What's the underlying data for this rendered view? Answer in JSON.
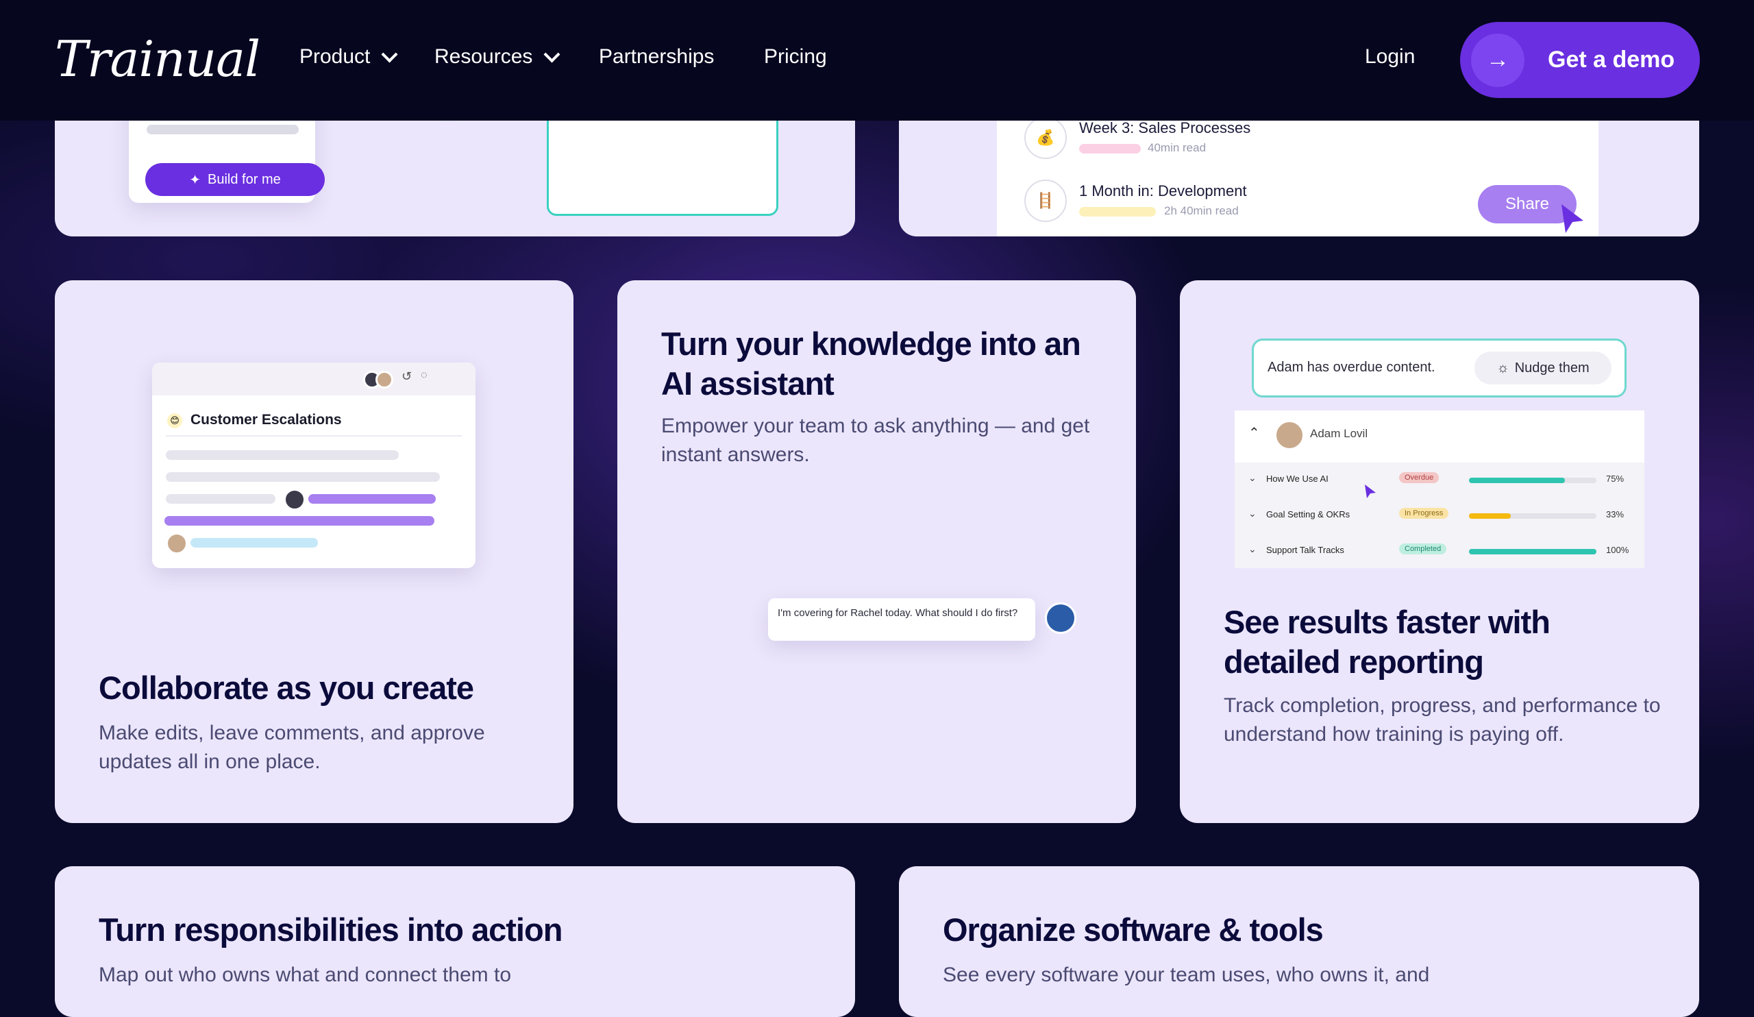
{
  "nav": {
    "logo": "Trainual",
    "items": [
      {
        "label": "Product",
        "dropdown": true
      },
      {
        "label": "Resources",
        "dropdown": true
      },
      {
        "label": "Partnerships",
        "dropdown": false
      },
      {
        "label": "Pricing",
        "dropdown": false
      }
    ],
    "login": "Login",
    "cta": "Get a demo"
  },
  "top_left_card": {
    "build_button": "Build for me"
  },
  "top_right_card": {
    "rows": [
      {
        "title": "Week 3: Sales Processes",
        "meta": "40min read",
        "icon": "moneybag-icon"
      },
      {
        "title": "1 Month in: Development",
        "meta": "2h 40min read",
        "icon": "ladder-icon"
      }
    ],
    "share_button": "Share"
  },
  "collab_card": {
    "doc_title": "Customer Escalations",
    "title": "Collaborate as you create",
    "desc": "Make edits, leave comments, and approve updates all in one place."
  },
  "ai_card": {
    "title": "Turn your knowledge into an AI assistant",
    "desc": "Empower your team to ask anything — and get instant answers.",
    "chat_message": "I'm covering for Rachel today. What should I do first?"
  },
  "reporting_card": {
    "notice": "Adam has overdue content.",
    "nudge_button": "Nudge them",
    "user_name": "Adam Lovil",
    "rows": [
      {
        "label": "How We Use AI",
        "status": "Overdue",
        "progress": 75,
        "percent_label": "75%"
      },
      {
        "label": "Goal Setting & OKRs",
        "status": "In Progress",
        "progress": 33,
        "percent_label": "33%"
      },
      {
        "label": "Support Talk Tracks",
        "status": "Completed",
        "progress": 100,
        "percent_label": "100%"
      }
    ],
    "title": "See results faster with detailed reporting",
    "desc": "Track completion, progress, and performance to understand how training is paying off."
  },
  "responsibilities_card": {
    "title": "Turn responsibilities into action",
    "desc": "Map out who owns what and connect them to"
  },
  "software_card": {
    "title": "Organize software & tools",
    "desc": "See every software your team uses, who owns it, and"
  },
  "colors": {
    "background": "#0a0a2a",
    "card": "#ece6fc",
    "accent": "#6a2fe0",
    "heading": "#0b0b3b",
    "body": "#4a4a72",
    "overdue": "#f4c6c6",
    "in_progress": "#fbe3a6",
    "completed": "#bfeee0"
  }
}
